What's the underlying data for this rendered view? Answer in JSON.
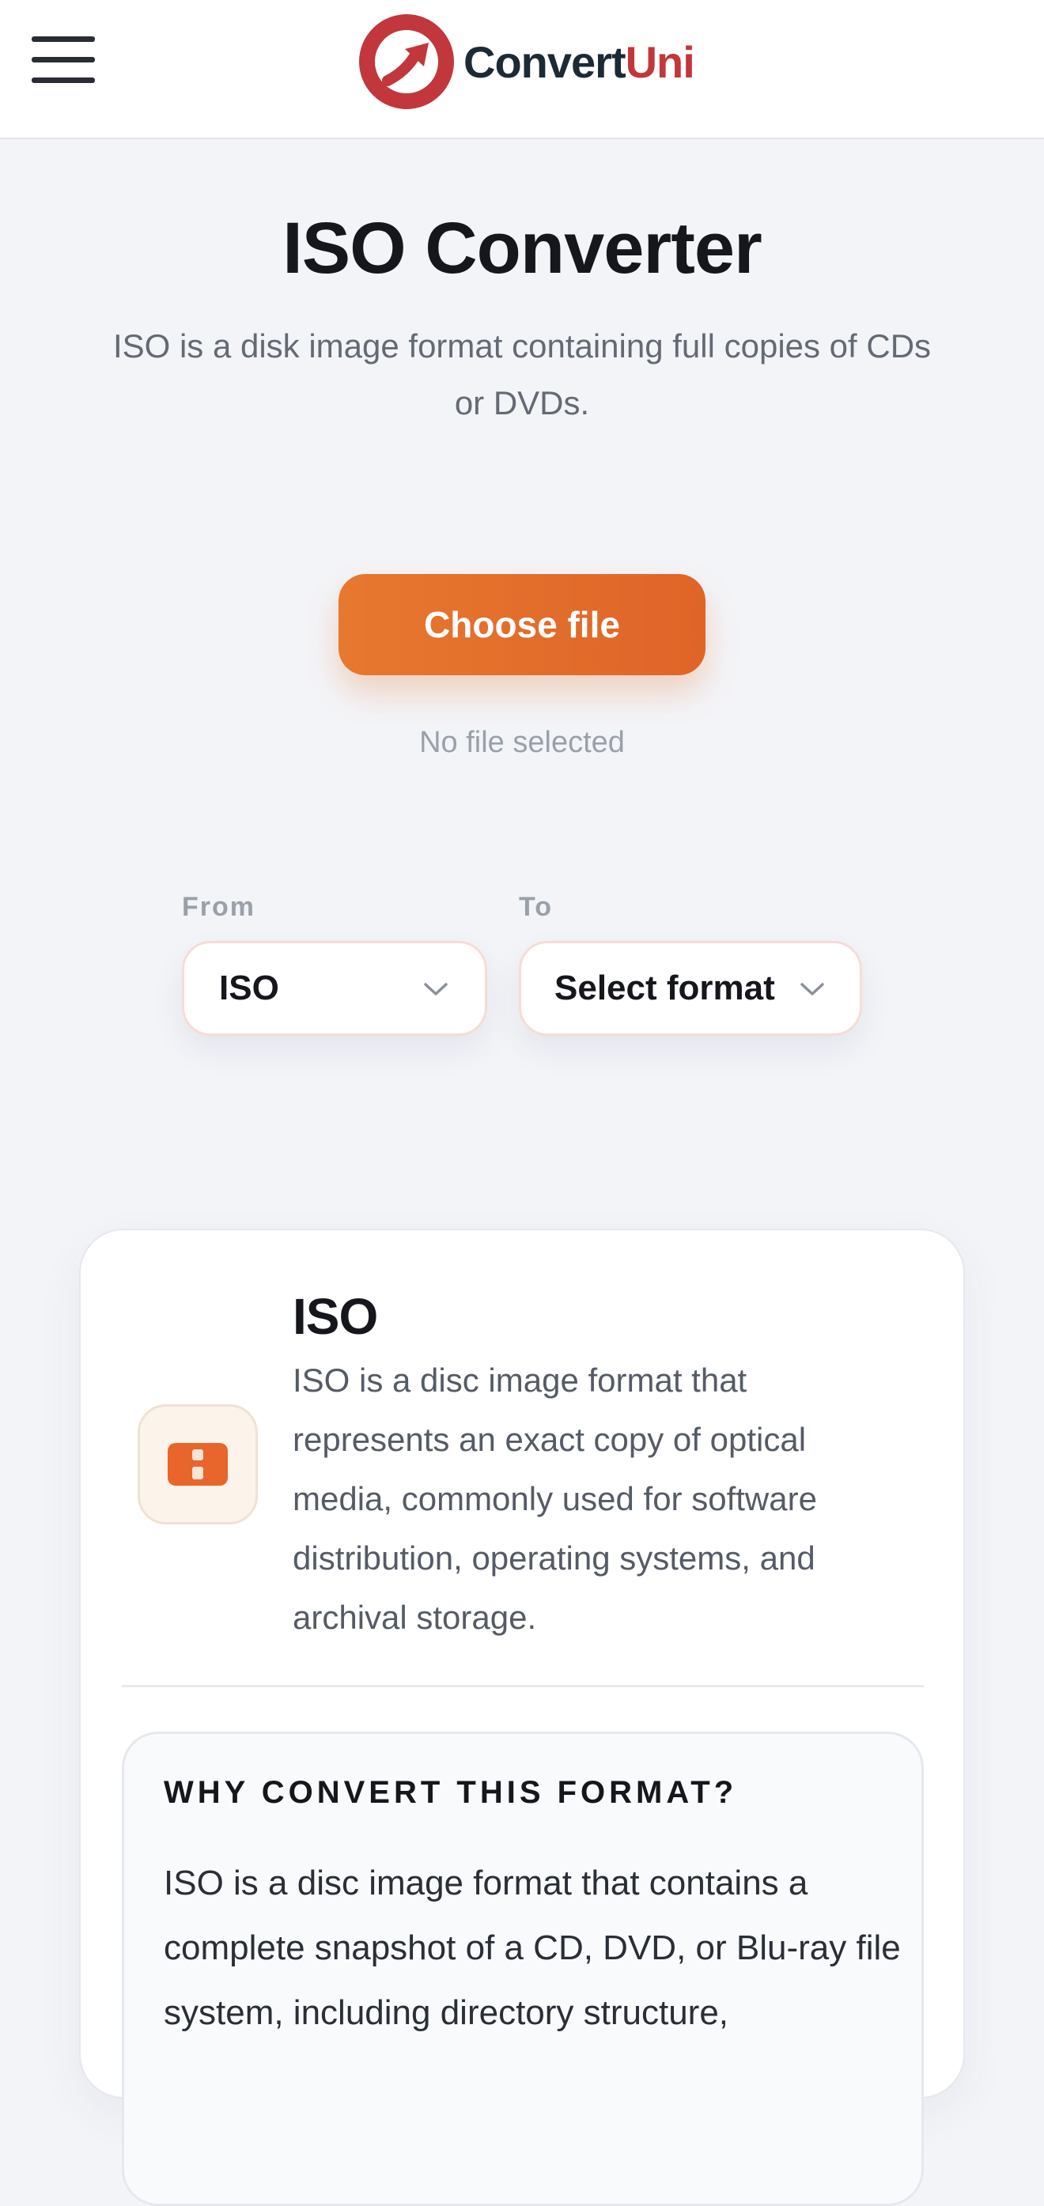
{
  "header": {
    "menu_icon": "hamburger-menu-icon",
    "brand": {
      "logo_icon": "convertuni-logo-arrow-icon",
      "name_part1": "Convert",
      "name_part2": "Uni",
      "color_dark": "#1c2a36",
      "color_accent": "#c2373b"
    }
  },
  "hero": {
    "title": "ISO Converter",
    "subtitle": "ISO is a disk image format containing full copies of CDs or DVDs."
  },
  "upload": {
    "button_label": "Choose file",
    "status": "No file selected",
    "button_color": "#e2692b"
  },
  "converter": {
    "from_label": "From",
    "from_value": "ISO",
    "to_label": "To",
    "to_value": "Select format",
    "dropdown_icon": "chevron-down-icon"
  },
  "format_card": {
    "icon": "disc-image-file-icon",
    "name": "ISO",
    "description": "ISO is a disc image format that represents an exact copy of optical media, commonly used for software distribution, operating systems, and archival storage.",
    "why": {
      "title": "WHY CONVERT THIS FORMAT?",
      "text": "ISO is a disc image format that contains a complete snapshot of a CD, DVD, or Blu-ray file system, including directory structure,"
    }
  }
}
